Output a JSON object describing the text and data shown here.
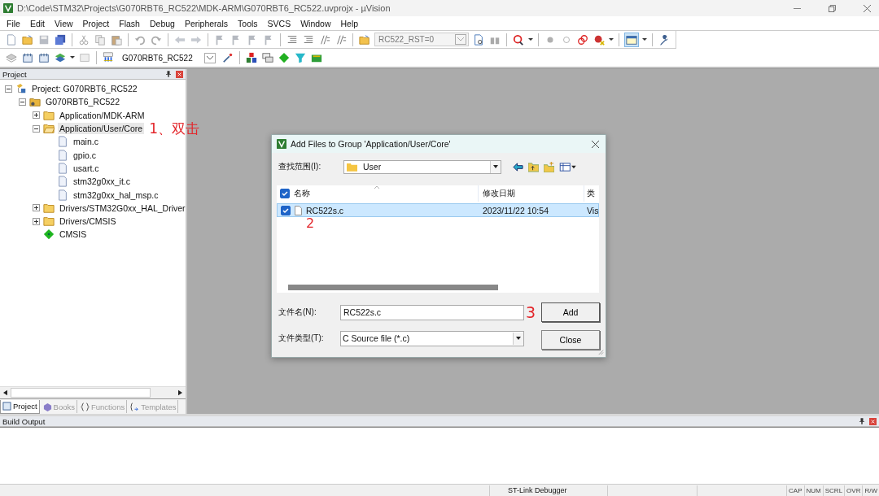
{
  "window": {
    "title": "D:\\Code\\STM32\\Projects\\G070RBT6_RC522\\MDK-ARM\\G070RBT6_RC522.uvprojx - µVision"
  },
  "menu": [
    "File",
    "Edit",
    "View",
    "Project",
    "Flash",
    "Debug",
    "Peripherals",
    "Tools",
    "SVCS",
    "Window",
    "Help"
  ],
  "toolbar": {
    "define_combo": "RC522_RST=0",
    "target_combo": "G070RBT6_RC522"
  },
  "project_panel": {
    "title": "Project",
    "tree": [
      {
        "label": "Project: G070RBT6_RC522",
        "kind": "project",
        "expanded": true,
        "selected": false,
        "children": [
          {
            "label": "G070RBT6_RC522",
            "kind": "target",
            "expanded": true,
            "selected": false,
            "children": [
              {
                "label": "Application/MDK-ARM",
                "kind": "group",
                "expanded": false,
                "selected": false
              },
              {
                "label": "Application/User/Core",
                "kind": "group",
                "expanded": true,
                "selected": true,
                "annotation": "1、双击",
                "children": [
                  {
                    "label": "main.c",
                    "kind": "file",
                    "selected": false
                  },
                  {
                    "label": "gpio.c",
                    "kind": "file",
                    "selected": false
                  },
                  {
                    "label": "usart.c",
                    "kind": "file",
                    "selected": false
                  },
                  {
                    "label": "stm32g0xx_it.c",
                    "kind": "file",
                    "selected": false
                  },
                  {
                    "label": "stm32g0xx_hal_msp.c",
                    "kind": "file",
                    "selected": false
                  }
                ]
              },
              {
                "label": "Drivers/STM32G0xx_HAL_Driver",
                "kind": "group",
                "expanded": false,
                "selected": false
              },
              {
                "label": "Drivers/CMSIS",
                "kind": "group",
                "expanded": false,
                "selected": false
              },
              {
                "label": "CMSIS",
                "kind": "component",
                "selected": false
              }
            ]
          }
        ]
      }
    ],
    "tabs": [
      {
        "label": "Project",
        "kind": "project",
        "selected": true
      },
      {
        "label": "Books",
        "kind": "books",
        "selected": false
      },
      {
        "label": "Functions",
        "kind": "functions",
        "selected": false
      },
      {
        "label": "Templates",
        "kind": "templates",
        "selected": false
      }
    ]
  },
  "dialog": {
    "title": "Add Files to Group 'Application/User/Core'",
    "look_in_label": "查找范围(I):",
    "look_in_value": "User",
    "columns": [
      "名称",
      "修改日期",
      "类"
    ],
    "header_checked": true,
    "files": [
      {
        "name": "RC522s.c",
        "modified": "2023/11/22 10:54",
        "type": "Vis",
        "checked": true,
        "selected": true,
        "annotation": "2"
      }
    ],
    "filename_label": "文件名(N):",
    "filename_value": "RC522s.c",
    "filetype_label": "文件类型(T):",
    "filetype_value": "C Source file (*.c)",
    "buttons": [
      {
        "label": "Add",
        "annotation": "3"
      },
      {
        "label": "Close"
      }
    ]
  },
  "build_output": {
    "title": "Build Output"
  },
  "status_bar": {
    "debugger": "ST-Link Debugger",
    "indicators": [
      "CAP",
      "NUM",
      "SCRL",
      "OVR",
      "R/W"
    ]
  }
}
